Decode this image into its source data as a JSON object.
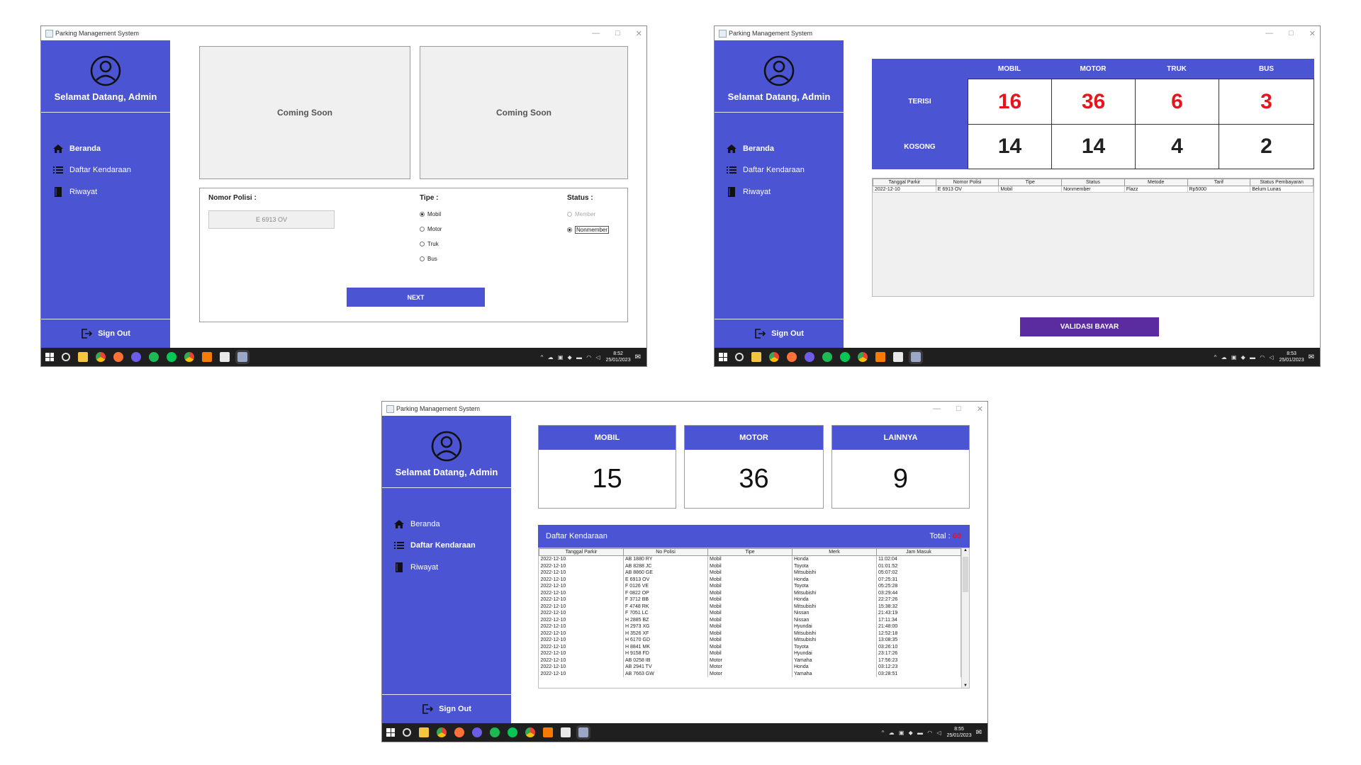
{
  "app": {
    "title": "Parking Management System",
    "welcome": "Selamat Datang, Admin",
    "nav": [
      "Beranda",
      "Daftar Kendaraan",
      "Riwayat"
    ],
    "sign_out": "Sign Out",
    "accent_color": "#4b55d4"
  },
  "window1": {
    "panel_left": "Coming Soon",
    "panel_right": "Coming Soon",
    "plate_label": "Nomor Polisi :",
    "plate_value": "E 6913 OV",
    "type_label": "Tipe :",
    "type_options": [
      "Mobil",
      "Motor",
      "Truk",
      "Bus"
    ],
    "type_selected": "Mobil",
    "status_label": "Status :",
    "status_options": [
      "Member",
      "Nonmember"
    ],
    "status_selected": "Nonmember",
    "next_button": "NEXT",
    "clock_time": "8:52",
    "clock_date": "25/01/2023"
  },
  "window2": {
    "columns": [
      "MOBIL",
      "MOTOR",
      "TRUK",
      "BUS"
    ],
    "rows": [
      {
        "label": "TERISI",
        "values": [
          "16",
          "36",
          "6",
          "3"
        ],
        "color": "#e8141c"
      },
      {
        "label": "KOSONG",
        "values": [
          "14",
          "14",
          "4",
          "2"
        ],
        "color": "#111111"
      }
    ],
    "table_headers": [
      "Tanggal Parkir",
      "Nomor Polisi",
      "Tipe",
      "Status",
      "Metode",
      "Tarif",
      "Status Pembayaran"
    ],
    "table_rows": [
      [
        "2022-12-10",
        "E 6913 OV",
        "Mobil",
        "Nonmember",
        "Flazz",
        "Rp5000",
        "Belum Lunas"
      ]
    ],
    "validate_button": "VALIDASI BAYAR",
    "validate_color": "#5b2ca0",
    "clock_time": "8:53",
    "clock_date": "25/01/2023"
  },
  "window3": {
    "cards": [
      {
        "label": "MOBIL",
        "value": "15"
      },
      {
        "label": "MOTOR",
        "value": "36"
      },
      {
        "label": "LAINNYA",
        "value": "9"
      }
    ],
    "list_title": "Daftar Kendaraan",
    "total_label": "Total :",
    "total_value": "60",
    "total_color": "#e8141c",
    "table_headers": [
      "Tanggal Parkir",
      "No Polisi",
      "Tipe",
      "Merk",
      "Jam Masuk"
    ],
    "table_rows": [
      [
        "2022-12-10",
        "AB 1880 RY",
        "Mobil",
        "Honda",
        "11:02:04"
      ],
      [
        "2022-12-10",
        "AB 8288 JC",
        "Mobil",
        "Toyota",
        "01:01:52"
      ],
      [
        "2022-12-10",
        "AB 8860 GE",
        "Mobil",
        "Mitsubishi",
        "05:07:02"
      ],
      [
        "2022-12-10",
        "E 6913 OV",
        "Mobil",
        "Honda",
        "07:25:31"
      ],
      [
        "2022-12-10",
        "F 0126 VE",
        "Mobil",
        "Toyota",
        "05:25:28"
      ],
      [
        "2022-12-10",
        "F 0822 OP",
        "Mobil",
        "Mitsubishi",
        "03:29:44"
      ],
      [
        "2022-12-10",
        "F 3712 BB",
        "Mobil",
        "Honda",
        "22:27:26"
      ],
      [
        "2022-12-10",
        "F 4748 RK",
        "Mobil",
        "Mitsubishi",
        "15:38:32"
      ],
      [
        "2022-12-10",
        "F 7051 LC",
        "Mobil",
        "Nissan",
        "21:43:19"
      ],
      [
        "2022-12-10",
        "H 2885 BZ",
        "Mobil",
        "Nissan",
        "17:11:34"
      ],
      [
        "2022-12-10",
        "H 2973 XG",
        "Mobil",
        "Hyundai",
        "21:48:00"
      ],
      [
        "2022-12-10",
        "H 3526 XF",
        "Mobil",
        "Mitsubishi",
        "12:52:18"
      ],
      [
        "2022-12-10",
        "H 6170 GD",
        "Mobil",
        "Mitsubishi",
        "13:08:35"
      ],
      [
        "2022-12-10",
        "H 8841 MK",
        "Mobil",
        "Toyota",
        "03:26:10"
      ],
      [
        "2022-12-10",
        "H 9158 FD",
        "Mobil",
        "Hyundai",
        "23:17:26"
      ],
      [
        "2022-12-10",
        "AB 0258 IB",
        "Motor",
        "Yamaha",
        "17:56:23"
      ],
      [
        "2022-12-10",
        "AB 2941 TV",
        "Motor",
        "Honda",
        "03:12:23"
      ],
      [
        "2022-12-10",
        "AB 7663 GW",
        "Motor",
        "Yamaha",
        "03:28:51"
      ]
    ],
    "clock_time": "8:55",
    "clock_date": "25/01/2023"
  }
}
